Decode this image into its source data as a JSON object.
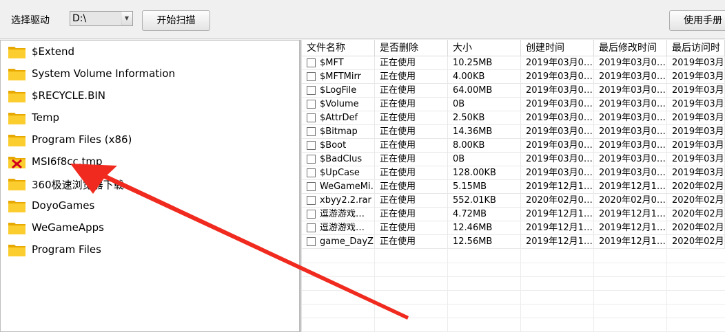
{
  "toolbar": {
    "drive_label": "选择驱动",
    "drive_value": "D:\\",
    "scan_button": "开始扫描",
    "manual_button": "使用手册"
  },
  "tree": [
    {
      "label": "$Extend",
      "icon": "folder-icon"
    },
    {
      "label": "System Volume Information",
      "icon": "folder-icon"
    },
    {
      "label": "$RECYCLE.BIN",
      "icon": "folder-icon"
    },
    {
      "label": "Temp",
      "icon": "folder-icon"
    },
    {
      "label": "Program Files (x86)",
      "icon": "folder-icon"
    },
    {
      "label": "MSI6f8cc.tmp",
      "icon": "deleted-folder-icon"
    },
    {
      "label": "360极速浏览器下载",
      "icon": "folder-icon"
    },
    {
      "label": "DoyoGames",
      "icon": "folder-icon"
    },
    {
      "label": "WeGameApps",
      "icon": "folder-icon"
    },
    {
      "label": "Program Files",
      "icon": "folder-icon"
    }
  ],
  "table": {
    "headers": [
      "文件名称",
      "是否删除",
      "大小",
      "创建时间",
      "最后修改时间",
      "最后访问时"
    ],
    "rows": [
      [
        "$MFT",
        "正在使用",
        "10.25MB",
        "2019年03月0…",
        "2019年03月0…",
        "2019年03月"
      ],
      [
        "$MFTMirr",
        "正在使用",
        "4.00KB",
        "2019年03月0…",
        "2019年03月0…",
        "2019年03月"
      ],
      [
        "$LogFile",
        "正在使用",
        "64.00MB",
        "2019年03月0…",
        "2019年03月0…",
        "2019年03月"
      ],
      [
        "$Volume",
        "正在使用",
        "0B",
        "2019年03月0…",
        "2019年03月0…",
        "2019年03月"
      ],
      [
        "$AttrDef",
        "正在使用",
        "2.50KB",
        "2019年03月0…",
        "2019年03月0…",
        "2019年03月"
      ],
      [
        "$Bitmap",
        "正在使用",
        "14.36MB",
        "2019年03月0…",
        "2019年03月0…",
        "2019年03月"
      ],
      [
        "$Boot",
        "正在使用",
        "8.00KB",
        "2019年03月0…",
        "2019年03月0…",
        "2019年03月"
      ],
      [
        "$BadClus",
        "正在使用",
        "0B",
        "2019年03月0…",
        "2019年03月0…",
        "2019年03月"
      ],
      [
        "$UpCase",
        "正在使用",
        "128.00KB",
        "2019年03月0…",
        "2019年03月0…",
        "2019年03月"
      ],
      [
        "WeGameMi…",
        "正在使用",
        "5.15MB",
        "2019年12月1…",
        "2019年12月1…",
        "2020年02月"
      ],
      [
        "xbyy2.2.rar",
        "正在使用",
        "552.01KB",
        "2020年02月0…",
        "2020年02月0…",
        "2020年02月"
      ],
      [
        "逗游游戏…",
        "正在使用",
        "4.72MB",
        "2019年12月1…",
        "2019年12月1…",
        "2020年02月"
      ],
      [
        "逗游游戏…",
        "正在使用",
        "12.46MB",
        "2019年12月1…",
        "2019年12月1…",
        "2020年02月"
      ],
      [
        "game_DayZ…",
        "正在使用",
        "12.56MB",
        "2019年12月1…",
        "2019年12月1…",
        "2020年02月"
      ]
    ]
  },
  "colors": {
    "folder": "#fccd2e",
    "folder_dark": "#e7a800",
    "deleted_mark": "#d0021b",
    "annotation_arrow": "#f02a1e"
  }
}
